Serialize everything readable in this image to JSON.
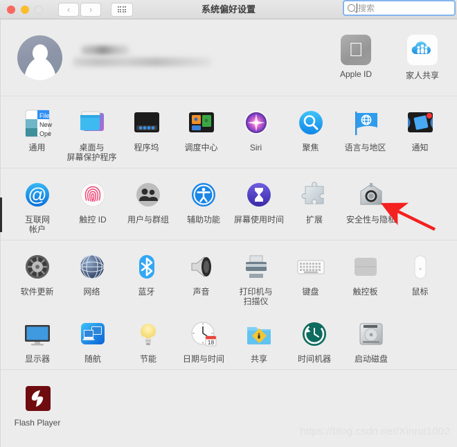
{
  "window": {
    "title": "系统偏好设置",
    "traffic_lights": [
      "close-red",
      "minimize-yellow",
      "zoom-disabled"
    ],
    "nav": {
      "back": "‹",
      "forward": "›",
      "grid": "grid-view-icon"
    }
  },
  "search": {
    "placeholder": "搜索",
    "icon": "search-icon",
    "value": ""
  },
  "account": {
    "avatar": "default-user-avatar",
    "name_redacted": true,
    "email_redacted": true,
    "items": [
      {
        "label": "Apple ID",
        "icon": "apple-logo-icon"
      },
      {
        "label": "家人共享",
        "icon": "family-sharing-cloud-icon"
      }
    ]
  },
  "sections": [
    {
      "name": "personal",
      "rows": [
        [
          {
            "label": "通用",
            "icon": "general-finder-icon"
          },
          {
            "label": "桌面与\n屏幕保护程序",
            "icon": "desktop-screensaver-icon"
          },
          {
            "label": "程序坞",
            "icon": "dock-icon"
          },
          {
            "label": "调度中心",
            "icon": "mission-control-icon"
          },
          {
            "label": "Siri",
            "icon": "siri-icon"
          },
          {
            "label": "聚焦",
            "icon": "spotlight-icon"
          },
          {
            "label": "语言与地区",
            "icon": "language-region-flag-icon"
          },
          {
            "label": "通知",
            "icon": "notifications-icon"
          }
        ]
      ]
    },
    {
      "name": "accounts",
      "rows": [
        [
          {
            "label": "互联网\n帐户",
            "icon": "internet-accounts-at-icon"
          },
          {
            "label": "触控 ID",
            "icon": "touch-id-fingerprint-icon"
          },
          {
            "label": "用户与群组",
            "icon": "users-groups-icon"
          },
          {
            "label": "辅助功能",
            "icon": "accessibility-icon"
          },
          {
            "label": "屏幕使用时间",
            "icon": "screen-time-hourglass-icon"
          },
          {
            "label": "扩展",
            "icon": "extensions-puzzle-icon"
          },
          {
            "label": "安全性与隐私",
            "icon": "security-privacy-house-icon"
          }
        ]
      ]
    },
    {
      "name": "hardware",
      "rows": [
        [
          {
            "label": "软件更新",
            "icon": "software-update-gear-icon"
          },
          {
            "label": "网络",
            "icon": "network-globe-icon"
          },
          {
            "label": "蓝牙",
            "icon": "bluetooth-icon"
          },
          {
            "label": "声音",
            "icon": "sound-speaker-icon"
          },
          {
            "label": "打印机与\n扫描仪",
            "icon": "printers-scanners-icon"
          },
          {
            "label": "键盘",
            "icon": "keyboard-icon"
          },
          {
            "label": "触控板",
            "icon": "trackpad-icon"
          },
          {
            "label": "鼠标",
            "icon": "mouse-icon"
          }
        ],
        [
          {
            "label": "显示器",
            "icon": "displays-monitor-icon"
          },
          {
            "label": "随航",
            "icon": "sidecar-icon"
          },
          {
            "label": "节能",
            "icon": "energy-saver-bulb-icon"
          },
          {
            "label": "日期与时间",
            "icon": "date-time-clock-icon",
            "badge_day": "18"
          },
          {
            "label": "共享",
            "icon": "sharing-folder-icon"
          },
          {
            "label": "时间机器",
            "icon": "time-machine-icon"
          },
          {
            "label": "启动磁盘",
            "icon": "startup-disk-icon"
          }
        ]
      ]
    },
    {
      "name": "other",
      "rows": [
        [
          {
            "label": "Flash Player",
            "icon": "flash-player-icon"
          }
        ]
      ]
    }
  ],
  "annotation": {
    "arrow": {
      "color": "#f52020",
      "target": "安全性与隐私"
    }
  },
  "watermark": "https://blog.csdn.net/Xinrui1002",
  "colors": {
    "window_bg": "#ececec",
    "accent_blue": "#2196f3",
    "arrow_red": "#f52020",
    "label_text": "#4c4c4c"
  }
}
